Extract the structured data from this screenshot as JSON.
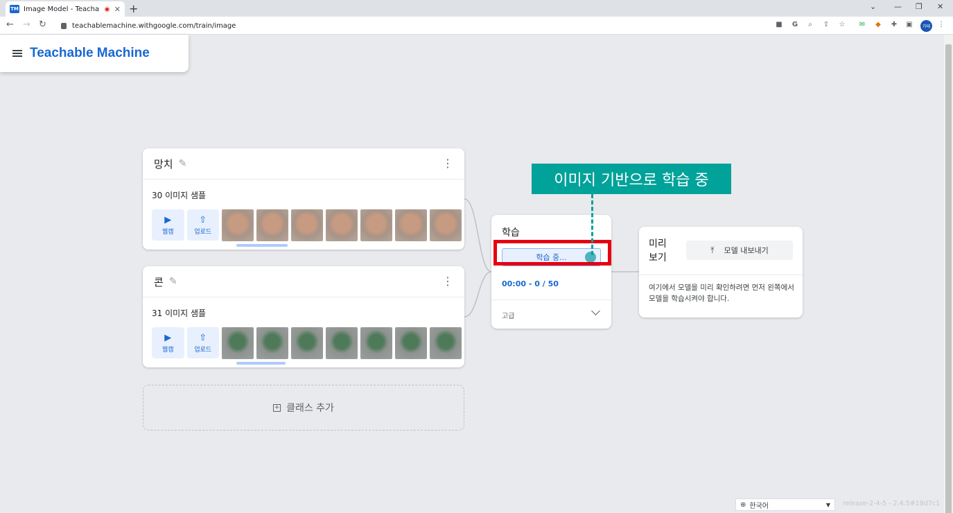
{
  "browser": {
    "tab_title": "Image Model - Teachable M",
    "favicon_text": "TM",
    "url": "teachablemachine.withgoogle.com/train/image",
    "profile_label": "가테"
  },
  "app": {
    "logo": "Teachable Machine"
  },
  "classes": [
    {
      "name": "망치",
      "sample_count_label": "30 이미지 샘플",
      "webcam_label": "웹캠",
      "upload_label": "업로드"
    },
    {
      "name": "콘",
      "sample_count_label": "31 이미지 샘플",
      "webcam_label": "웹캠",
      "upload_label": "업로드"
    }
  ],
  "add_class_label": "클래스 추가",
  "training": {
    "title": "학습",
    "button_label": "학습 중...",
    "time_progress": "00:00 - 0 / 50",
    "advanced_label": "고급"
  },
  "annotation": {
    "callout_text": "이미지 기반으로 학습 중",
    "highlight_color": "#e60012",
    "callout_color": "#00a29a"
  },
  "preview": {
    "title": "미리 보기",
    "export_label": "모델 내보내기",
    "message": "여기에서 모델을 미리 확인하려면 먼저 왼쪽에서 모델을 학습시켜야 합니다."
  },
  "footer": {
    "language": "한국어",
    "release": "release-2-4-5 - 2.4.5#18d7c1"
  },
  "colors": {
    "accent": "#1967d2",
    "background": "#e8eaed"
  }
}
